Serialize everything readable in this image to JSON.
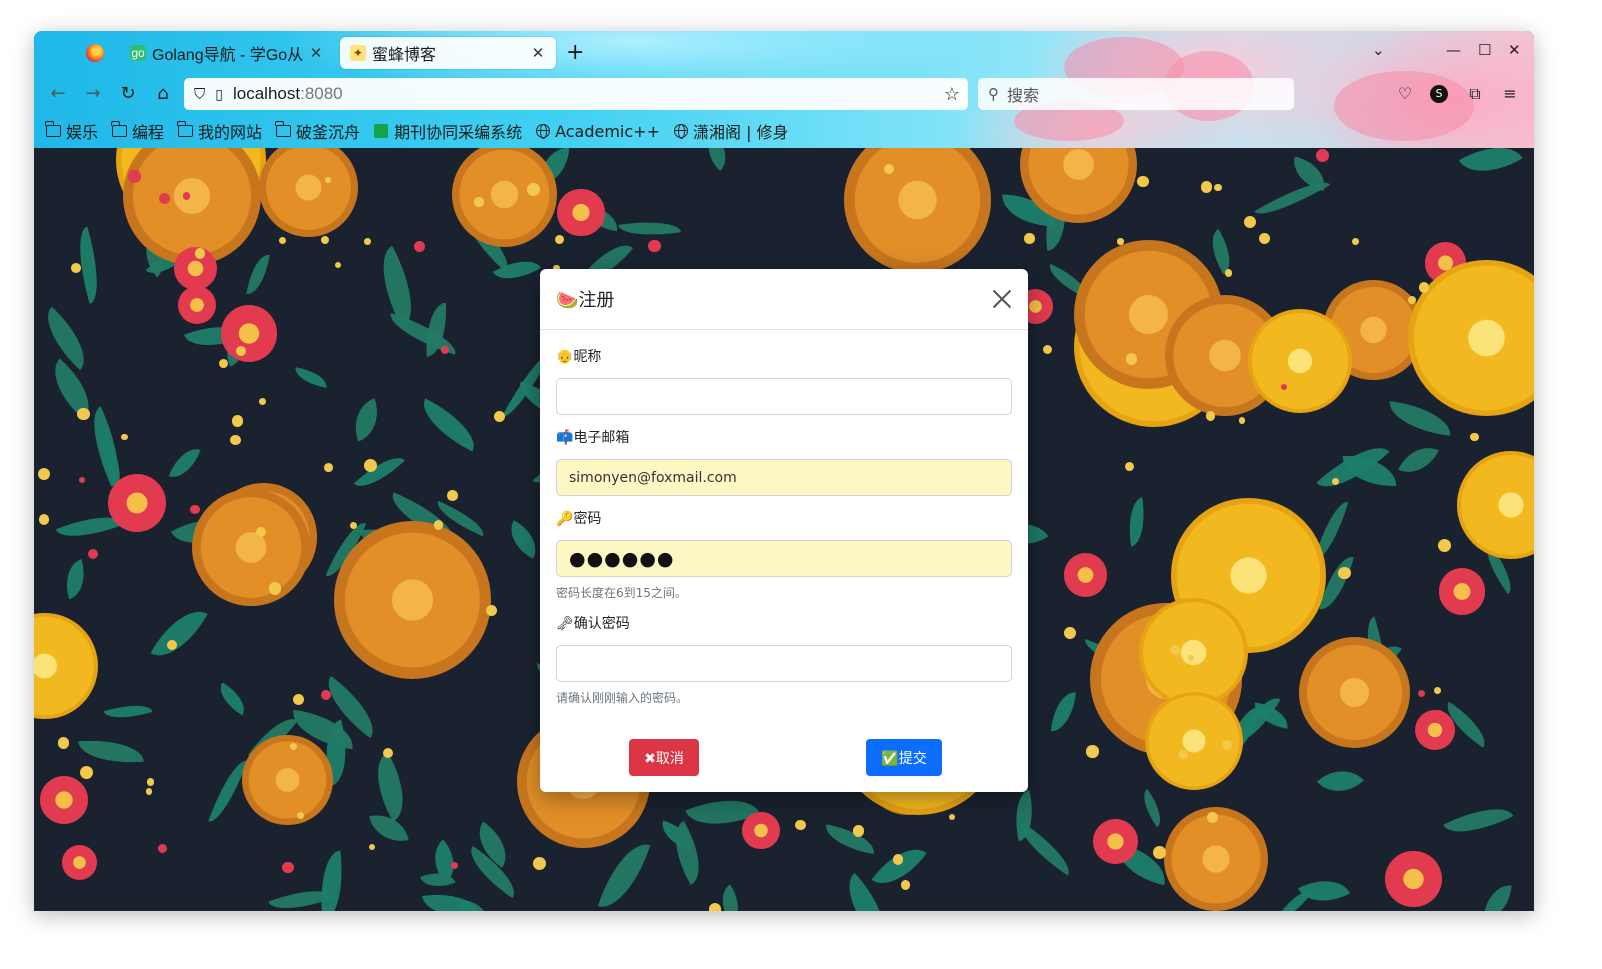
{
  "browser": {
    "tabs": [
      {
        "title": "Golang导航 - 学Go从",
        "active": false
      },
      {
        "title": "蜜蜂博客",
        "active": true
      }
    ],
    "url": {
      "host": "localhost",
      "port": ":8080"
    },
    "search_placeholder": "搜索",
    "bookmarks": [
      {
        "label": "娱乐",
        "icon": "folder-icon"
      },
      {
        "label": "编程",
        "icon": "folder-icon"
      },
      {
        "label": "我的网站",
        "icon": "folder-icon"
      },
      {
        "label": "破釜沉舟",
        "icon": "folder-icon"
      },
      {
        "label": "期刊协同采编系统",
        "icon": "green-site-icon"
      },
      {
        "label": "Academic++",
        "icon": "globe-icon"
      },
      {
        "label": "潇湘阁 | 修身",
        "icon": "globe-icon"
      }
    ]
  },
  "modal": {
    "title_icon": "🍉",
    "title": "注册",
    "fields": {
      "nickname": {
        "icon": "👴",
        "label": "昵称",
        "value": ""
      },
      "email": {
        "icon": "📫",
        "label": "电子邮箱",
        "value": "simonyen@foxmail.com"
      },
      "password": {
        "icon": "🔑",
        "label": "密码",
        "value": "●●●●●●",
        "help": "密码长度在6到15之间。"
      },
      "confirm": {
        "icon": "🗝",
        "label": "确认密码",
        "value": "",
        "help": "请确认刚刚输入的密码。"
      }
    },
    "cancel_label": "✖取消",
    "submit_label": "✅提交"
  },
  "colors": {
    "cancel": "#dc3545",
    "submit": "#0d6efd",
    "autofill": "#fdf7c4"
  }
}
